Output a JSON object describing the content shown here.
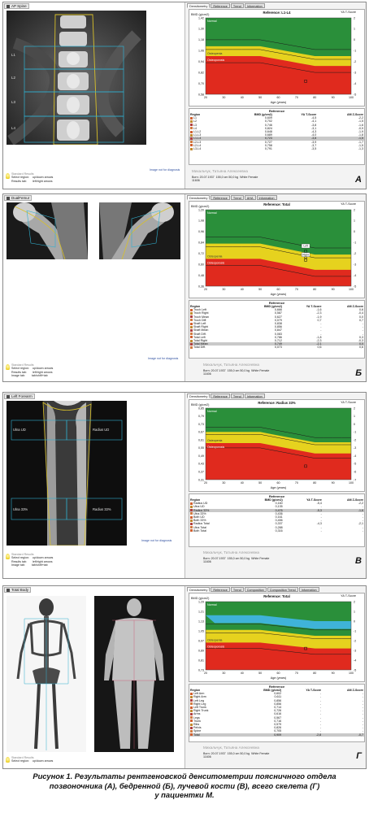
{
  "common": {
    "patient_name": "Михальчук, Татьяна Алексеевна",
    "born": "Born: 20.07.1937",
    "height_weight": "155,0 cm  50,0 kg",
    "ethnicity": "White Female",
    "patient_id": "11606",
    "image_not_diag": "Image not for diagnosis",
    "results_header": "Standard Results",
    "results_lines": [
      "Select region:",
      "Results tab:",
      "Image tab:"
    ],
    "results_keys": [
      "up/down arrows",
      "left/right arrows",
      "tab/shift+tab"
    ],
    "yt_label": "YA T-Score",
    "x_label": "Age (years)",
    "zone_normal": "Normal",
    "zone_osteopenia": "Osteopenia",
    "zone_osteoporosis": "Osteoporosis",
    "colors": {
      "normal": "#2a8f3a",
      "osteopenia": "#e6d21e",
      "osteoporosis": "#e02a1e",
      "compare": "#3fb3d8"
    }
  },
  "panelA": {
    "scan_title": "AP Spine",
    "labels": [
      "L1",
      "L2",
      "L3",
      "L4"
    ],
    "tabs": [
      "Densitometry",
      "Reference",
      "Trend",
      "Information"
    ],
    "reference": "Reference: L1-L4",
    "bmd_label": "BMD (g/cm2)",
    "y_ticks": [
      "1,42",
      "1,30",
      "1,18",
      "1,06",
      "0,94",
      "0,82",
      "0,70",
      "0,58"
    ],
    "t_ticks": [
      "2",
      "1",
      "0",
      "-1",
      "-2",
      "-3",
      "-4",
      "-5"
    ],
    "x_ticks": [
      "20",
      "30",
      "40",
      "50",
      "60",
      "70",
      "80",
      "90",
      "100"
    ],
    "letter": "A",
    "table_ref": "Reference",
    "table_head": [
      "Region",
      "BMD (g/cm2)",
      "YA T-Score",
      "AM Z-Score"
    ],
    "rows": [
      [
        "L1",
        "0,609",
        "-4,5",
        "-2,2"
      ],
      [
        "L2",
        "0,702",
        "-4,1",
        "-1,5"
      ],
      [
        "L3",
        "0,746",
        "-3,8",
        "-1,6"
      ],
      [
        "L4",
        "0,824",
        "-3,1",
        "-0,9"
      ],
      [
        "L1-L2",
        "0,648",
        "-4,3",
        "-1,9"
      ],
      [
        "L1-L3",
        "0,689",
        "-4,0",
        "-1,8"
      ],
      [
        "L1-L4",
        "0,723",
        "-3,8",
        "-1,5"
      ],
      [
        "L2-L3",
        "0,727",
        "-3,9",
        "-1,7"
      ],
      [
        "L2-L4",
        "0,758",
        "-3,7",
        "-1,5"
      ],
      [
        "L3-L4",
        "0,791",
        "-3,5",
        "-1,3"
      ]
    ],
    "selected_row": 6
  },
  "panelB": {
    "scan_title": "DualFemur",
    "tabs": [
      "Densitometry",
      "Reference",
      "Trend",
      "AHA",
      "Information"
    ],
    "reference": "Reference: Total",
    "bmd_label": "BMD (g/cm2)",
    "y_ticks": [
      "1,20",
      "1,08",
      "0,96",
      "0,84",
      "0,72",
      "0,60",
      "0,48",
      "0,36"
    ],
    "t_ticks": [
      "2",
      "1",
      "0",
      "-1",
      "-2",
      "-3",
      "-4",
      "-5"
    ],
    "x_ticks": [
      "20",
      "30",
      "40",
      "50",
      "60",
      "70",
      "80",
      "90",
      "100"
    ],
    "markers": [
      "Left",
      "Right"
    ],
    "letter": "Б",
    "table_ref": "Reference",
    "table_head": [
      "Region",
      "BMD (g/cm2)",
      "YA T-Score",
      "AM Z-Score"
    ],
    "rows": [
      [
        "Troch Left",
        "0,666",
        "-1,6",
        "0,6"
      ],
      [
        "Troch Right",
        "0,587",
        "-2,3",
        "-0,4"
      ],
      [
        "Troch Mean",
        "0,627",
        "-1,9",
        "0,0"
      ],
      [
        "Troch Diff.",
        "0,079",
        "0,7",
        "0,7"
      ],
      [
        "Shaft Left",
        "0,838",
        "-",
        "-"
      ],
      [
        "Shaft Right",
        "0,856",
        "-",
        "-"
      ],
      [
        "Shaft Mean",
        "0,847",
        "-",
        "-"
      ],
      [
        "Shaft Diff.",
        "0,083",
        "-",
        "-"
      ],
      [
        "Total Left",
        "0,786",
        "-1,8",
        "0,3"
      ],
      [
        "Total Right",
        "0,712",
        "-2,3",
        "-0,3"
      ],
      [
        "Total Mean",
        "0,749",
        "-2,1",
        "0,0"
      ],
      [
        "Total Diff.",
        "0,073",
        "0,6",
        "0,6"
      ]
    ],
    "selected_row": 10
  },
  "panelV": {
    "scan_title": "Left Forearm",
    "labels": [
      "Ulna UD",
      "Radius UD",
      "Ulna 33%",
      "Radius 33%"
    ],
    "tabs": [
      "Densitometry",
      "Reference",
      "Trend",
      "Information"
    ],
    "reference": "Reference: Radius 33%",
    "bmd_label": "BMD (g/cm2)",
    "y_ticks": [
      "0,85",
      "0,79",
      "0,73",
      "0,67",
      "0,61",
      "0,55",
      "0,49",
      "0,43",
      "0,37",
      "0,31"
    ],
    "t_ticks": [
      "2",
      "1",
      "0",
      "-1",
      "-2",
      "-3",
      "-4",
      "-5",
      "-6",
      "-7"
    ],
    "x_ticks": [
      "20",
      "30",
      "40",
      "50",
      "60",
      "70",
      "80",
      "90",
      "100"
    ],
    "letter": "В",
    "table_ref": "Reference",
    "table_head": [
      "Region",
      "BMD (g/cm2)",
      "YA T-Score",
      "AM Z-Score"
    ],
    "rows": [
      [
        "Radius UD",
        "0,160",
        "-5,4",
        "-2,2"
      ],
      [
        "Ulna UD",
        "0,135",
        "-",
        "-"
      ],
      [
        "Radius 33%",
        "0,476",
        "-5,3",
        "-1,6"
      ],
      [
        "Ulna 33%",
        "0,436",
        "-",
        "-"
      ],
      [
        "Both UD",
        "0,161",
        "-",
        "-"
      ],
      [
        "Both 33%",
        "0,456",
        "-",
        "-"
      ],
      [
        "Radius Total",
        "0,337",
        "-4,3",
        "-2,1"
      ],
      [
        "Ulna Total",
        "0,288",
        "-",
        "-"
      ],
      [
        "Both Total",
        "0,316",
        "-",
        "-"
      ]
    ],
    "selected_row": 2
  },
  "panelG": {
    "scan_title": "Total Body",
    "tabs": [
      "Densitometry",
      "Reference",
      "Trend",
      "Composition",
      "Composition Trend",
      "Information"
    ],
    "reference": "Reference: Total",
    "bmd_label": "BMD (g/cm2)",
    "y_ticks": [
      "1,29",
      "1,21",
      "1,13",
      "1,05",
      "0,97",
      "0,89",
      "0,81",
      "0,73"
    ],
    "t_ticks": [
      "2",
      "1",
      "0",
      "-1",
      "-2",
      "-3",
      "-4",
      "-5"
    ],
    "x_ticks": [
      "20",
      "30",
      "40",
      "50",
      "60",
      "70",
      "80",
      "90",
      "100"
    ],
    "letter": "Г",
    "table_ref": "Reference",
    "table_head": [
      "Region",
      "BMD (g/cm2)",
      "YA T-Score",
      "AM Z-Score"
    ],
    "rows": [
      [
        "Left Arm",
        "0,602",
        "-",
        "-"
      ],
      [
        "Right Arm",
        "0,611",
        "-",
        "-"
      ],
      [
        "Left Leg",
        "0,856",
        "-",
        "-"
      ],
      [
        "Right Leg",
        "0,856",
        "-",
        "-"
      ],
      [
        "Left Trunk",
        "0,714",
        "-",
        "-"
      ],
      [
        "Right Trunk",
        "0,726",
        "-",
        "-"
      ],
      [
        "Arms",
        "0,616",
        "-",
        "-"
      ],
      [
        "Legs",
        "0,567",
        "-",
        "-"
      ],
      [
        "Trunk",
        "0,716",
        "-",
        "-"
      ],
      [
        "Ribs",
        "0,579",
        "-",
        "-"
      ],
      [
        "Pelvis",
        "0,826",
        "-",
        "-"
      ],
      [
        "Spine",
        "0,705",
        "-",
        "-"
      ],
      [
        "Total",
        "0,909",
        "-2,8",
        "-0,7"
      ]
    ],
    "selected_row": 12
  },
  "caption": {
    "line1": "Рисунок 1. Результаты рентгеновской денситометрии поясничного отдела",
    "line2": "позвоночника (А), бедренной (Б), лучевой кости (В), всего скелета (Г)",
    "line3": "у пациентки М."
  }
}
